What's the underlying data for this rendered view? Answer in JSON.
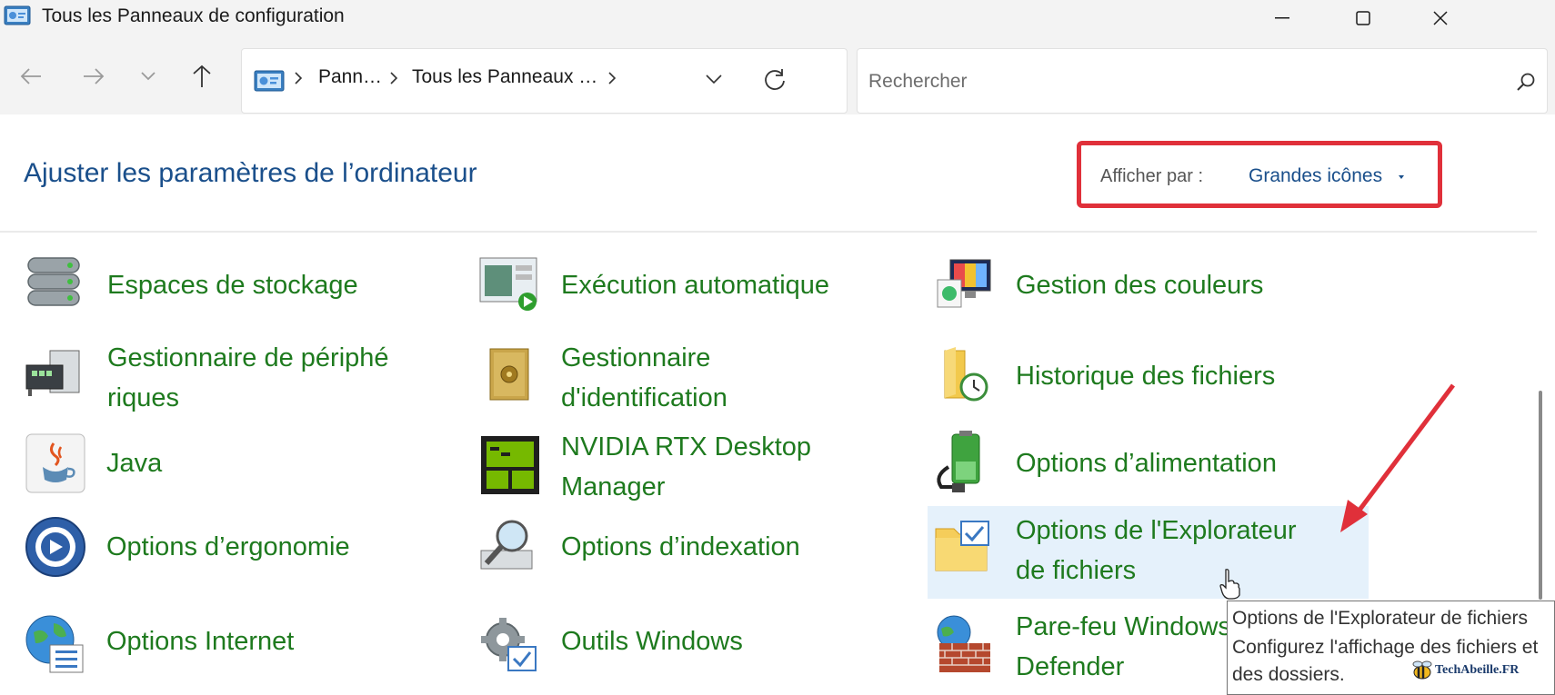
{
  "window": {
    "title": "Tous les Panneaux de configuration"
  },
  "nav": {
    "breadcrumb": [
      "Pann…",
      "Tous les Panneaux …"
    ]
  },
  "search": {
    "placeholder": "Rechercher"
  },
  "header": {
    "title": "Ajuster les paramètres de l’ordinateur",
    "view_by_label": "Afficher par :",
    "view_by_value": "Grandes icônes"
  },
  "items": [
    {
      "label": "Espaces de stockage",
      "icon": "storage-spaces-icon"
    },
    {
      "label": "Exécution automatique",
      "icon": "autoplay-icon"
    },
    {
      "label": "Gestion des couleurs",
      "icon": "color-management-icon"
    },
    {
      "label_lines": [
        "Gestionnaire de périphé",
        "riques"
      ],
      "icon": "device-manager-icon"
    },
    {
      "label_lines": [
        "Gestionnaire",
        "d'identification"
      ],
      "icon": "credential-manager-icon"
    },
    {
      "label": "Historique des fichiers",
      "icon": "file-history-icon"
    },
    {
      "label": "Java",
      "icon": "java-icon"
    },
    {
      "label_lines": [
        "NVIDIA RTX Desktop",
        "Manager"
      ],
      "icon": "nvidia-icon"
    },
    {
      "label": "Options d’alimentation",
      "icon": "power-options-icon"
    },
    {
      "label": "Options d’ergonomie",
      "icon": "ease-of-access-icon"
    },
    {
      "label": "Options d’indexation",
      "icon": "indexing-options-icon"
    },
    {
      "label_lines": [
        "Options de l'Explorateur",
        "de fichiers"
      ],
      "icon": "file-explorer-options-icon",
      "hovered": true
    },
    {
      "label": "Options Internet",
      "icon": "internet-options-icon"
    },
    {
      "label": "Outils Windows",
      "icon": "windows-tools-icon"
    },
    {
      "label_lines": [
        "Pare-feu Windows",
        "Defender"
      ],
      "icon": "firewall-icon"
    }
  ],
  "tooltip": {
    "lines": [
      "Options de l'Explorateur de fichiers",
      "Configurez l'affichage des fichiers et",
      "des dossiers."
    ]
  },
  "watermark": "TechAbeille.FR",
  "colors": {
    "link_green": "#1e7a1e",
    "title_blue": "#1a4f8b",
    "highlight_red": "#e0303a",
    "hover_bg": "#e5f1fb"
  }
}
